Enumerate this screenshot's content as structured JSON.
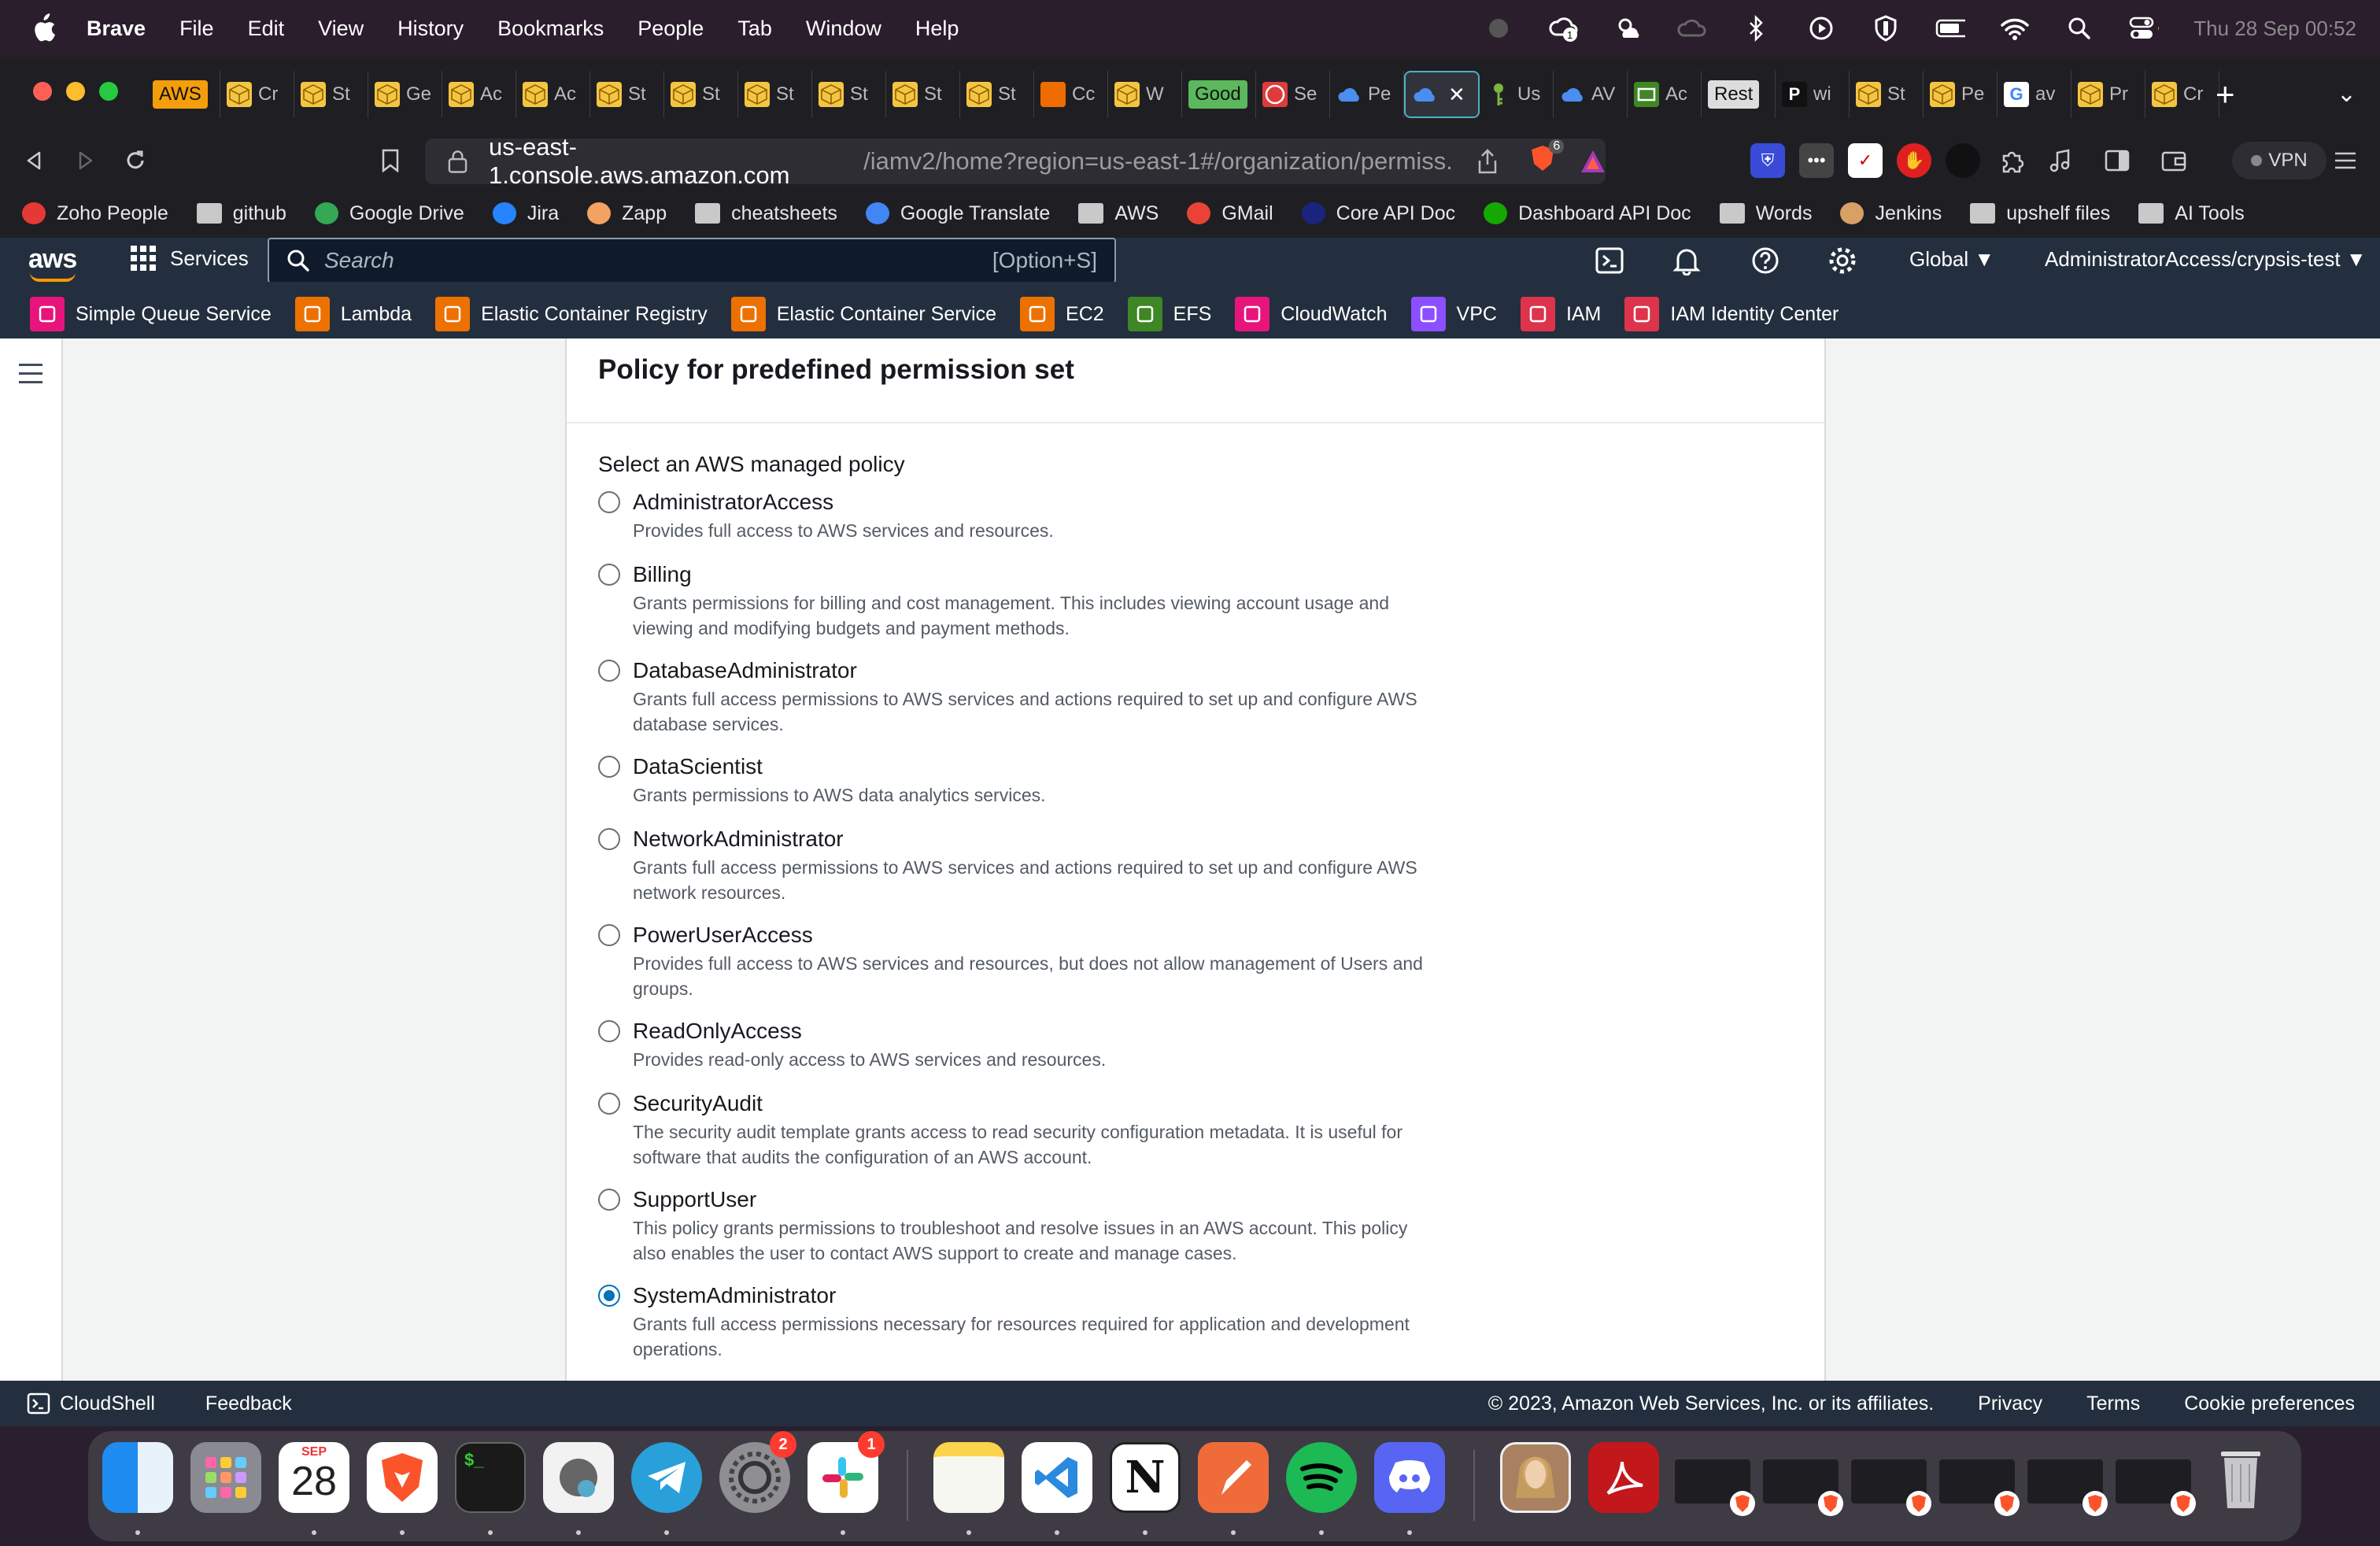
{
  "menubar": {
    "app": "Brave",
    "items": [
      "File",
      "Edit",
      "View",
      "History",
      "Bookmarks",
      "People",
      "Tab",
      "Window",
      "Help"
    ],
    "clock": "Thu 28 Sep  00:52"
  },
  "tabs": [
    {
      "label": "AWS",
      "fav": "aws-box"
    },
    {
      "label": "Cr",
      "fav": "box"
    },
    {
      "label": "St",
      "fav": "box"
    },
    {
      "label": "Ge",
      "fav": "box"
    },
    {
      "label": "Ac",
      "fav": "box"
    },
    {
      "label": "Ac",
      "fav": "box"
    },
    {
      "label": "St",
      "fav": "box"
    },
    {
      "label": "St",
      "fav": "box"
    },
    {
      "label": "St",
      "fav": "box"
    },
    {
      "label": "St",
      "fav": "box"
    },
    {
      "label": "St",
      "fav": "box"
    },
    {
      "label": "St",
      "fav": "box"
    },
    {
      "label": "Cc",
      "fav": "orange"
    },
    {
      "label": "W",
      "fav": "box"
    },
    {
      "label": "Good",
      "fav": "green-box"
    },
    {
      "label": "Se",
      "fav": "red"
    },
    {
      "label": "Pe",
      "fav": "cloud"
    },
    {
      "label": "",
      "fav": "cloud",
      "active": true
    },
    {
      "label": "Us",
      "fav": "key"
    },
    {
      "label": "AV",
      "fav": "cloud"
    },
    {
      "label": "Ac",
      "fav": "green"
    },
    {
      "label": "Rest",
      "fav": "white-box"
    },
    {
      "label": "wi",
      "fav": "p"
    },
    {
      "label": "St",
      "fav": "box"
    },
    {
      "label": "Pe",
      "fav": "box"
    },
    {
      "label": "av",
      "fav": "google"
    },
    {
      "label": "Pr",
      "fav": "box"
    },
    {
      "label": "Cr",
      "fav": "box"
    }
  ],
  "urlbar": {
    "host": "us-east-1.console.aws.amazon.com",
    "path": "/iamv2/home?region=us-east-1#/organization/permiss..."
  },
  "brave_badge": "6",
  "vpn": "VPN",
  "bookmarks": [
    {
      "label": "Zoho People",
      "icon": "zoho-icon"
    },
    {
      "label": "github",
      "icon": "folder-icon"
    },
    {
      "label": "Google Drive",
      "icon": "google-drive-icon"
    },
    {
      "label": "Jira",
      "icon": "jira-icon"
    },
    {
      "label": "Zapp",
      "icon": "zapp-icon"
    },
    {
      "label": "cheatsheets",
      "icon": "folder-icon"
    },
    {
      "label": "Google Translate",
      "icon": "translate-icon"
    },
    {
      "label": "AWS",
      "icon": "folder-icon"
    },
    {
      "label": "GMail",
      "icon": "gmail-icon"
    },
    {
      "label": "Core API Doc",
      "icon": "api-icon"
    },
    {
      "label": "Dashboard API Doc",
      "icon": "upwork-icon"
    },
    {
      "label": "Words",
      "icon": "folder-icon"
    },
    {
      "label": "Jenkins",
      "icon": "jenkins-icon"
    },
    {
      "label": "upshelf files",
      "icon": "folder-icon"
    },
    {
      "label": "AI Tools",
      "icon": "folder-icon"
    }
  ],
  "aws_header": {
    "logo": "aws",
    "services": "Services",
    "search_placeholder": "Search",
    "search_shortcut": "[Option+S]",
    "region": "Global ▼",
    "account": "AdministratorAccess/crypsis-test ▼"
  },
  "favorites": [
    {
      "label": "Simple Queue Service",
      "color": "#e7157b"
    },
    {
      "label": "Lambda",
      "color": "#ed7100"
    },
    {
      "label": "Elastic Container Registry",
      "color": "#ed7100"
    },
    {
      "label": "Elastic Container Service",
      "color": "#ed7100"
    },
    {
      "label": "EC2",
      "color": "#ed7100"
    },
    {
      "label": "EFS",
      "color": "#3f8624"
    },
    {
      "label": "CloudWatch",
      "color": "#e7157b"
    },
    {
      "label": "VPC",
      "color": "#8c4fff"
    },
    {
      "label": "IAM",
      "color": "#dd344c"
    },
    {
      "label": "IAM Identity Center",
      "color": "#dd344c"
    }
  ],
  "panel": {
    "title": "Policy for predefined permission set",
    "section_label": "Select an AWS managed policy",
    "options": [
      {
        "name": "AdministratorAccess",
        "desc": [
          "Provides full access to AWS services and resources."
        ],
        "checked": false
      },
      {
        "name": "Billing",
        "desc": [
          "Grants permissions for billing and cost management. This includes viewing account usage and",
          "viewing and modifying budgets and payment methods."
        ],
        "checked": false
      },
      {
        "name": "DatabaseAdministrator",
        "desc": [
          "Grants full access permissions to AWS services and actions required to set up and configure AWS",
          "database services."
        ],
        "checked": false
      },
      {
        "name": "DataScientist",
        "desc": [
          "Grants permissions to AWS data analytics services."
        ],
        "checked": false
      },
      {
        "name": "NetworkAdministrator",
        "desc": [
          "Grants full access permissions to AWS services and actions required to set up and configure AWS",
          "network resources."
        ],
        "checked": false
      },
      {
        "name": "PowerUserAccess",
        "desc": [
          "Provides full access to AWS services and resources, but does not allow management of Users and",
          "groups."
        ],
        "checked": false
      },
      {
        "name": "ReadOnlyAccess",
        "desc": [
          "Provides read-only access to AWS services and resources."
        ],
        "checked": false
      },
      {
        "name": "SecurityAudit",
        "desc": [
          "The security audit template grants access to read security configuration metadata. It is useful for",
          "software that audits the configuration of an AWS account."
        ],
        "checked": false
      },
      {
        "name": "SupportUser",
        "desc": [
          "This policy grants permissions to troubleshoot and resolve issues in an AWS account. This policy",
          "also enables the user to contact AWS support to create and manage cases."
        ],
        "checked": false
      },
      {
        "name": "SystemAdministrator",
        "desc": [
          "Grants full access permissions necessary for resources required for application and development",
          "operations."
        ],
        "checked": true
      }
    ]
  },
  "footer": {
    "cloudshell": "CloudShell",
    "feedback": "Feedback",
    "copyright": "© 2023, Amazon Web Services, Inc. or its affiliates.",
    "privacy": "Privacy",
    "terms": "Terms",
    "cookie": "Cookie preferences"
  },
  "dock": {
    "calendar_month": "SEP",
    "calendar_day": "28",
    "settings_badge": "2",
    "slack_badge": "1"
  }
}
